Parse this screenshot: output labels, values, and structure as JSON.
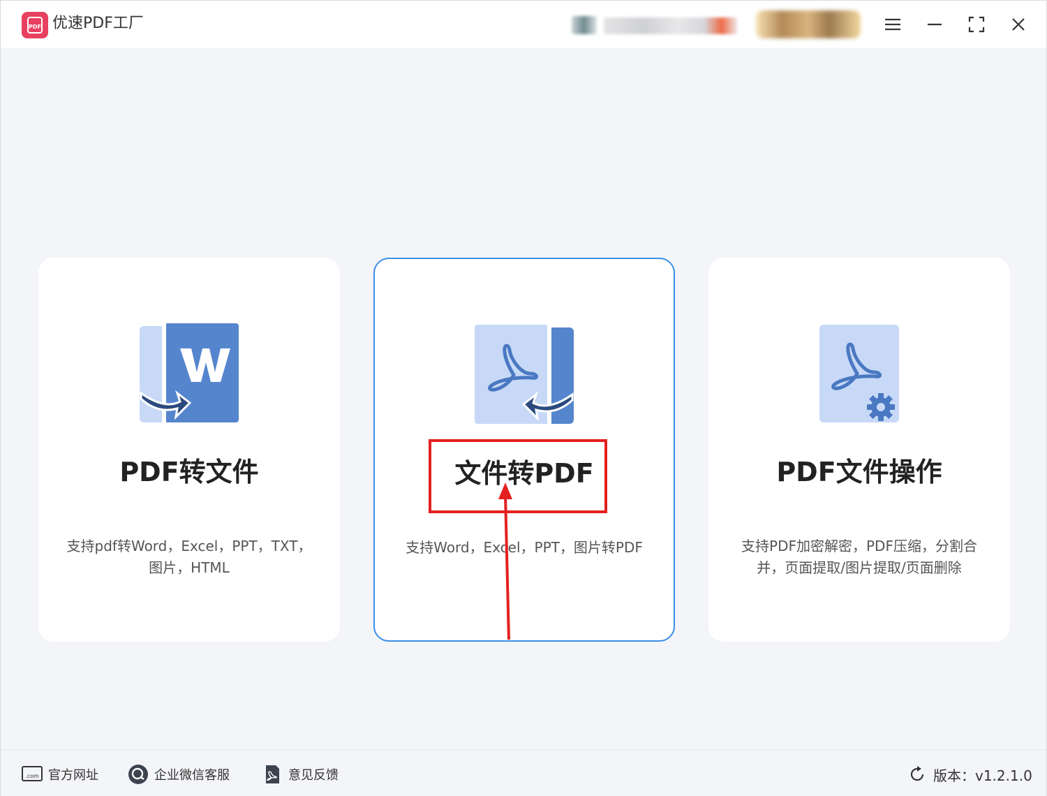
{
  "app": {
    "title": "优速PDF工厂",
    "logo_text": "PDF"
  },
  "accent": "#3a8ee6",
  "annotation_color": "#e52020",
  "cards": [
    {
      "title": "PDF转文件",
      "desc_line1": "支持pdf转Word，Excel，PPT，TXT，",
      "desc_line2": "图片，HTML",
      "icon": "pdf-to-word-icon"
    },
    {
      "title": "文件转PDF",
      "desc_line1": "支持Word，Excel，PPT，图片转PDF",
      "desc_line2": "",
      "icon": "word-to-pdf-icon"
    },
    {
      "title": "PDF文件操作",
      "desc_line1": "支持PDF加密解密，PDF压缩，分割合",
      "desc_line2": "并，页面提取/图片提取/页面删除",
      "icon": "pdf-settings-icon"
    }
  ],
  "footer": {
    "website": "官方网址",
    "website_icon_text": ".com",
    "wechat": "企业微信客服",
    "feedback": "意见反馈",
    "version": "版本：v1.2.1.0"
  }
}
